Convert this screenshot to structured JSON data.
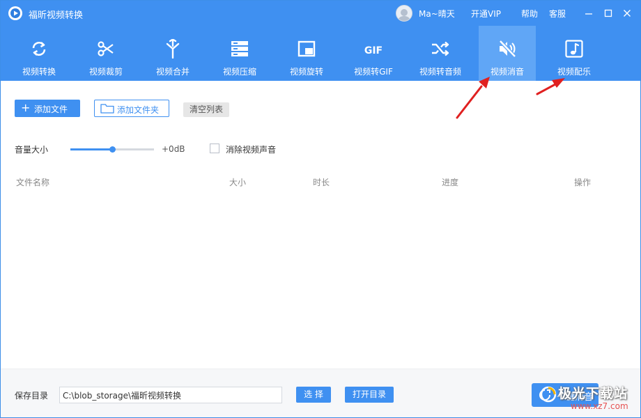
{
  "window": {
    "title": "福昕视频转换",
    "user": "Ma~晴天",
    "links": {
      "vip": "开通VIP",
      "help": "帮助",
      "service": "客服"
    }
  },
  "toolbar": {
    "tools": [
      {
        "label": "视频转换",
        "icon": "refresh-icon"
      },
      {
        "label": "视频裁剪",
        "icon": "scissors-icon"
      },
      {
        "label": "视频合并",
        "icon": "merge-icon"
      },
      {
        "label": "视频压缩",
        "icon": "compress-icon"
      },
      {
        "label": "视频旋转",
        "icon": "rotate-icon"
      },
      {
        "label": "视频转GIF",
        "icon": "gif-icon"
      },
      {
        "label": "视频转音频",
        "icon": "shuffle-icon"
      },
      {
        "label": "视频消音",
        "icon": "mute-icon",
        "active": true
      },
      {
        "label": "视频配乐",
        "icon": "music-note-icon"
      }
    ]
  },
  "actions": {
    "add_file": "添加文件",
    "add_folder": "添加文件夹",
    "clear_list": "清空列表"
  },
  "volume": {
    "label": "音量大小",
    "level": 0.5,
    "value": "+0dB",
    "mute_label": "消除视频声音",
    "mute_checked": false
  },
  "table": {
    "columns": [
      "文件名称",
      "大小",
      "时长",
      "进度",
      "操作"
    ],
    "rows": []
  },
  "footer": {
    "save_dir_label": "保存目录",
    "save_path": "C:\\blob_storage\\福昕视频转换",
    "choose_button": "选 择",
    "open_dir_button": "打开目录",
    "start_button": "一键消音"
  },
  "watermark": {
    "line1": "极光下载站",
    "line2": "www.xz7.com"
  },
  "colors": {
    "primary": "#3f90f1",
    "active_tab": "#60a6f6",
    "annotation_arrow": "#e02020"
  }
}
